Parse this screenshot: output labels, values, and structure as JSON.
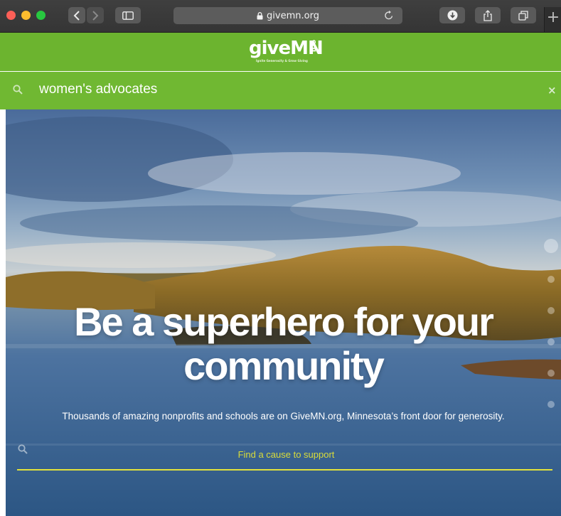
{
  "browser": {
    "url": "givemn.org",
    "new_tab": "+",
    "colors": {
      "close": "#fc5f57",
      "minimize": "#fdbc2e",
      "zoom": "#28c840"
    }
  },
  "site": {
    "logo_text": "giveMN",
    "logo_suffix": "org",
    "logo_tagline": "Ignite Generosity & Grow Giving",
    "brand_color": "#6cb42f",
    "search": {
      "query": "women's advocates",
      "clear_label": "×"
    }
  },
  "hero": {
    "headline_line1": "Be a superhero for your",
    "headline_line2": "community",
    "subtext": "Thousands of amazing nonprofits and schools are on GiveMN.org, Minnesota’s front door for generosity.",
    "search_placeholder": "Find a cause to support",
    "accent_color": "#e2e23c"
  }
}
